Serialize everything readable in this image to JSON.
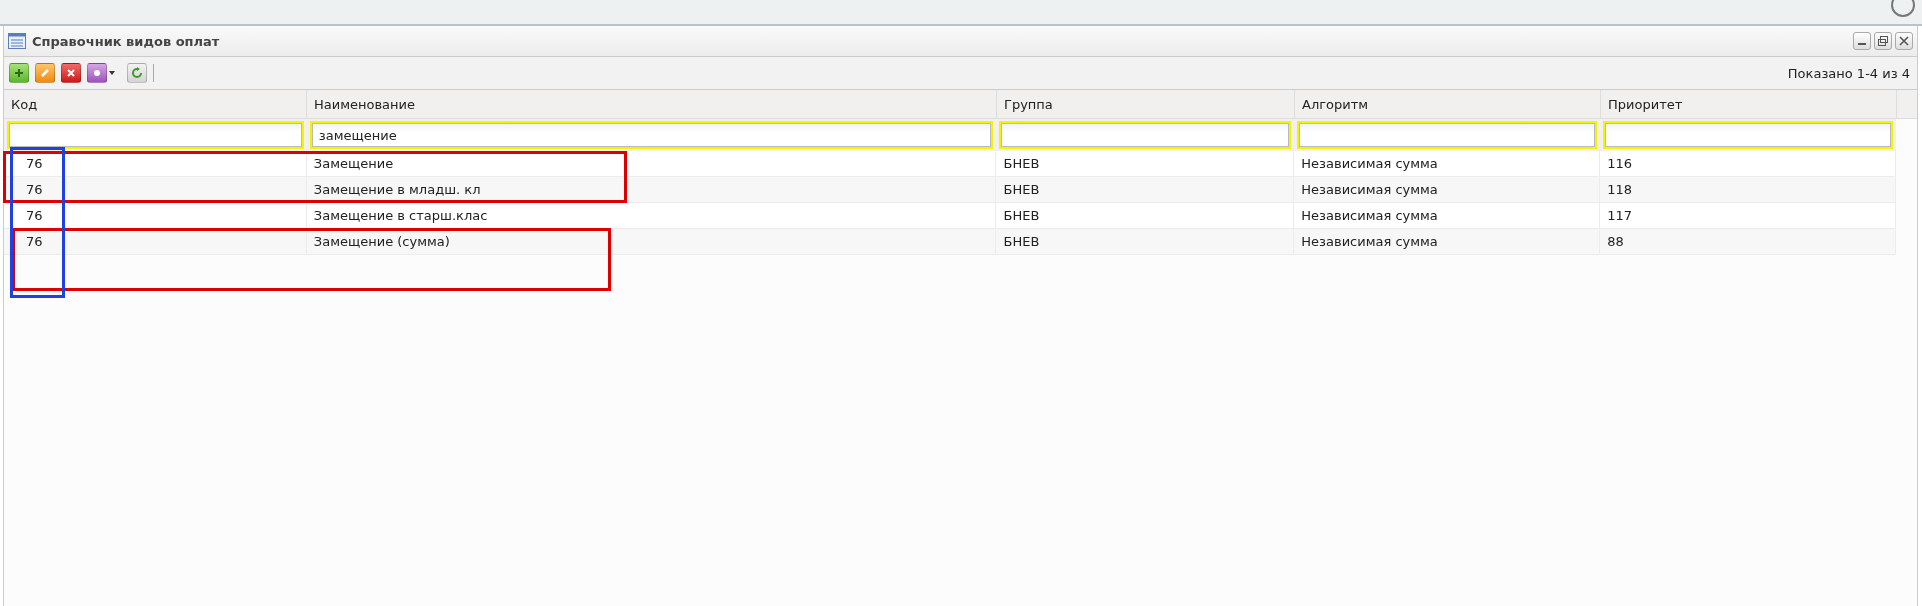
{
  "window": {
    "title": "Справочник видов оплат"
  },
  "toolbar": {
    "status": "Показано 1-4 из 4"
  },
  "table": {
    "columns": [
      {
        "label": "Код"
      },
      {
        "label": "Наименование",
        "filter": "замещение"
      },
      {
        "label": "Группа"
      },
      {
        "label": "Алгоритм"
      },
      {
        "label": "Приоритет"
      }
    ],
    "rows": [
      {
        "cells": [
          "76",
          "Замещение",
          "БНЕВ",
          "Независимая сумма",
          "116"
        ]
      },
      {
        "cells": [
          "76",
          "Замещение в младш. кл",
          "БНЕВ",
          "Независимая сумма",
          "118"
        ]
      },
      {
        "cells": [
          "76",
          "Замещение в старш.клас",
          "БНЕВ",
          "Независимая сумма",
          "117"
        ]
      },
      {
        "cells": [
          "76",
          "Замещение (сумма)",
          "БНЕВ",
          "Независимая сумма",
          "88"
        ]
      }
    ]
  },
  "annotations": [
    {
      "color": "#dd0000"
    },
    {
      "color": "#dd0000"
    },
    {
      "color": "#2040e0"
    }
  ]
}
